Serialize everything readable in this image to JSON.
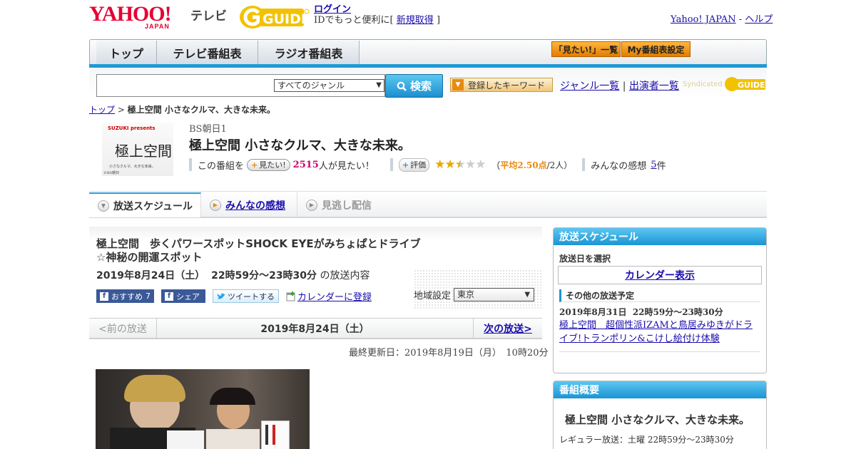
{
  "header": {
    "logo_text": "YAHOO!",
    "logo_sub": "JAPAN",
    "tv_label": "テレビ",
    "gguide_logo": "G-GUIDE",
    "login_label": "ログイン",
    "login_desc_prefix": "IDでもっと便利に[",
    "signup_label": "新規取得",
    "login_desc_suffix": "]",
    "yahoo_japan_link": "Yahoo! JAPAN",
    "link_sep": "-",
    "help_link": "ヘルプ"
  },
  "nav": {
    "tabs": [
      {
        "label": "トップ"
      },
      {
        "label": "テレビ番組表"
      },
      {
        "label": "ラジオ番組表"
      }
    ],
    "mitai_list_btn": "「見たい!」一覧",
    "my_bangumi_btn": "My番組表設定"
  },
  "search": {
    "input_value": "",
    "genre_selected": "すべてのジャンル",
    "search_btn": "検索",
    "keyword_btn": "登録したキーワード",
    "genre_list_link": "ジャンル一覧",
    "links_sep": "|",
    "performer_list_link": "出演者一覧",
    "syndicated_label": "Syndicated"
  },
  "breadcrumb": {
    "top": "トップ",
    "sep": ">",
    "current": "極上空間 小さなクルマ、大きな未来。"
  },
  "program": {
    "logo_brand": "SUZUKI presents",
    "logo_title": "極上空間",
    "logo_sub": "小さなクルマ、大きな未来。",
    "logo_station": "©BS朝日",
    "station": "BS朝日1",
    "title": "極上空間 小さなクルマ、大きな未来。",
    "mitai_prefix": "この番組を",
    "mitai_btn": "見たい!",
    "mitai_count": "2515",
    "mitai_suffix": "人が見たい！",
    "hyoka_btn": "評価",
    "rating": 2.5,
    "rating_open": "（",
    "rating_avg_label": "平均2.50点",
    "rating_count": "/2人）",
    "kansou_label": "みんなの感想",
    "kansou_count": "5",
    "kansou_unit": "件"
  },
  "subtabs": [
    {
      "label": "放送スケジュール"
    },
    {
      "label": "みんなの感想"
    },
    {
      "label": "見逃し配信"
    }
  ],
  "episode": {
    "title": "極上空間　歩くパワースポットSHOCK EYEがみちょぱとドライブ☆神秘の開運スポット",
    "date": "2019年8月24日（土）",
    "time": "22時59分～23時30分",
    "date_suffix": "の放送内容",
    "fb_recommend": "おすすめ",
    "fb_count": "7",
    "fb_share": "シェア",
    "tweet": "ツイートする",
    "calendar_add": "カレンダーに登録",
    "region_label": "地域設定",
    "region_value": "東京"
  },
  "episode_nav": {
    "prev": "<前の放送",
    "date": "2019年8月24日（土）",
    "next": "次の放送>"
  },
  "updated": "最終更新日：2019年8月19日（月）　10時20分",
  "sidebar": {
    "schedule_title": "放送スケジュール",
    "select_date": "放送日を選択",
    "calendar_btn": "カレンダー表示",
    "other_schedule": "その他の放送予定",
    "next_date": "2019年8月31日",
    "next_time": "22時59分～23時30分",
    "next_title": "極上空間　超個性派IZAMと鳥居みゆきがドライブ!トランポリン&こけし絵付け体験",
    "overview_title": "番組概要",
    "overview_program": "極上空間 小さなクルマ、大きな未来。",
    "regular_label": "レギュラー放送：土曜",
    "regular_time": "22時59分～23時30分"
  }
}
